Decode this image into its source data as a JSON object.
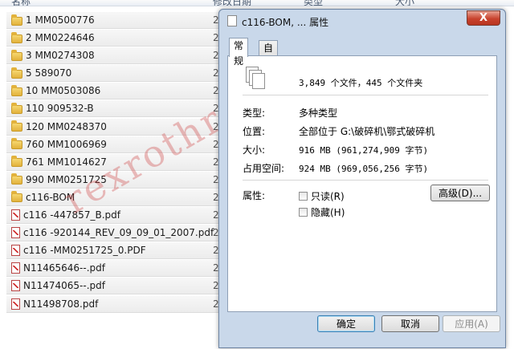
{
  "explorer": {
    "columns": [
      "名称",
      "修改日期",
      "类型",
      "大小"
    ],
    "rows": [
      {
        "name": "1  MM0500776",
        "type": "folder",
        "date": "2("
      },
      {
        "name": "2  MM0224646",
        "type": "folder",
        "date": "2("
      },
      {
        "name": "3  MM0274308",
        "type": "folder",
        "date": "2("
      },
      {
        "name": "5  589070",
        "type": "folder",
        "date": "2("
      },
      {
        "name": "10  MM0503086",
        "type": "folder",
        "date": "2("
      },
      {
        "name": "110  909532-B",
        "type": "folder",
        "date": "2("
      },
      {
        "name": "120  MM0248370",
        "type": "folder",
        "date": "2("
      },
      {
        "name": "760  MM1006969",
        "type": "folder",
        "date": "2("
      },
      {
        "name": "761  MM1014627",
        "type": "folder",
        "date": "2("
      },
      {
        "name": "990  MM0251725",
        "type": "folder",
        "date": "2("
      },
      {
        "name": "c116-BOM",
        "type": "folder",
        "date": "2("
      },
      {
        "name": "c116 -447857_B.pdf",
        "type": "pdf",
        "date": "2("
      },
      {
        "name": "c116 -920144_REV_09_09_01_2007.pdf",
        "type": "pdf",
        "date": "2("
      },
      {
        "name": "c116 -MM0251725_0.PDF",
        "type": "pdf",
        "date": "2("
      },
      {
        "name": "N11465646--.pdf",
        "type": "pdf",
        "date": "2("
      },
      {
        "name": "N11474065--.pdf",
        "type": "pdf",
        "date": "2("
      },
      {
        "name": "N11498708.pdf",
        "type": "pdf",
        "date": "2("
      }
    ]
  },
  "dialog": {
    "title": "c116-BOM, ... 属性",
    "close_label": "X",
    "tabs": [
      "常规",
      "自定义"
    ],
    "summary": "3,849 个文件，445 个文件夹",
    "fields": [
      {
        "label": "类型:",
        "value": "多种类型",
        "mono": false
      },
      {
        "label": "位置:",
        "value": "全部位于 G:\\破碎机\\鄂式破碎机",
        "mono": false
      },
      {
        "label": "大小:",
        "value": "916 MB (961,274,909 字节)",
        "mono": true
      },
      {
        "label": "占用空间:",
        "value": "924 MB (969,056,256 字节)",
        "mono": true
      }
    ],
    "attributes_label": "属性:",
    "readonly_label": "只读(R)",
    "hidden_label": "隐藏(H)",
    "advanced_label": "高级(D)...",
    "ok_label": "确定",
    "cancel_label": "取消",
    "apply_label": "应用(A)"
  },
  "watermark": "rexrothroller"
}
